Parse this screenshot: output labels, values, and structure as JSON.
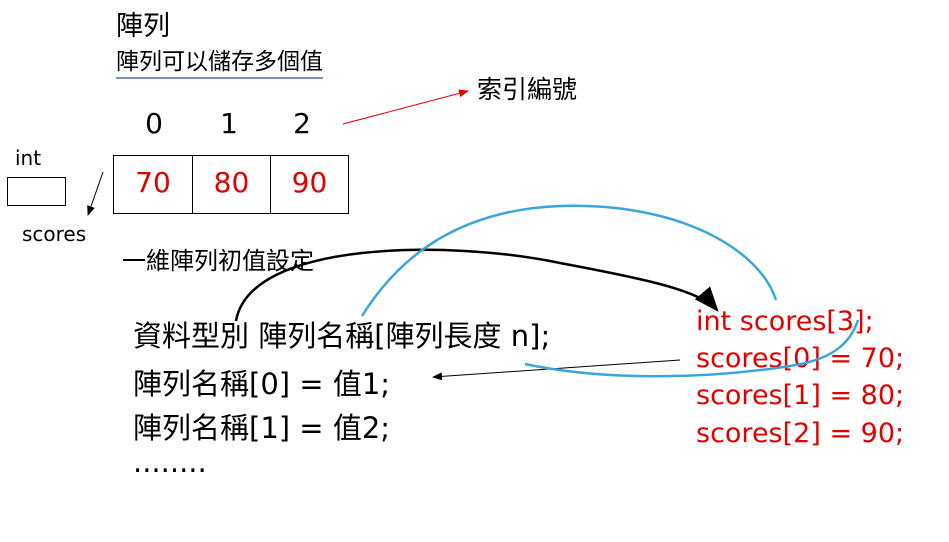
{
  "title": "陣列",
  "subtitle": "陣列可以儲存多個值",
  "index_label": "索引編號",
  "indices": [
    "0",
    "1",
    "2"
  ],
  "variable": {
    "type": "int",
    "name": "scores"
  },
  "array_values": [
    "70",
    "80",
    "90"
  ],
  "init_label": "一維陣列初值設定",
  "syntax_lines": [
    "資料型別 陣列名稱[陣列長度 n];",
    "陣列名稱[0] = 值1;",
    "陣列名稱[1] = 值2;",
    "........"
  ],
  "code_lines": [
    "int scores[3];",
    "scores[0] = 70;",
    "scores[1] = 80;",
    "scores[2] = 90;"
  ],
  "colors": {
    "highlight": "#e00000",
    "curve_blue": "#3aa6dc",
    "underline": "#7a90bd",
    "arrow_red": "#e00000"
  }
}
